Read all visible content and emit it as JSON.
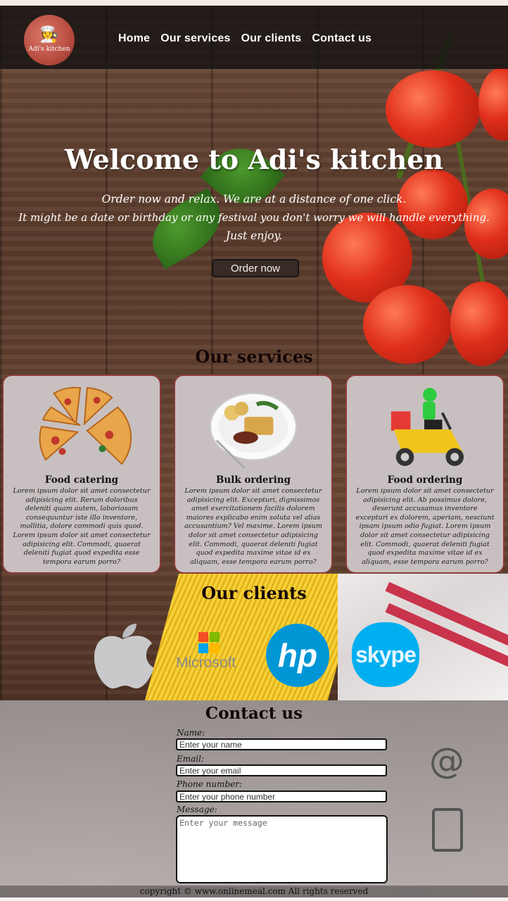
{
  "header": {
    "logo_text": "Adi's kitchen",
    "nav": [
      "Home",
      "Our services",
      "Our clients",
      "Contact us"
    ]
  },
  "hero": {
    "title": "Welcome to Adi's kitchen",
    "lines": [
      "Order now and relax. We are at a distance of one click.",
      "It might be a date or birthday or any festival you don't worry we will handle everything.",
      "Just enjoy."
    ],
    "order_button": "Order now"
  },
  "services": {
    "title": "Our services",
    "cards": [
      {
        "title": "Food catering",
        "icon": "pizza-icon",
        "text": "Lorem ipsum dolor sit amet consectetur adipisicing elit. Rerum doloribus deleniti quam autem, laboriosam consequuntur iste illo inventore, mollitia, dolore commodi quis quod. Lorem ipsum dolor sit amet consectetur adipisicing elit. Commodi, quaerat deleniti fugiat quod expedita esse tempora earum porro?"
      },
      {
        "title": "Bulk ordering",
        "icon": "meal-plate-icon",
        "text": "Lorem ipsum dolor sit amet consectetur adipisicing elit. Excepturi, dignissimos amet exercitationem facilis dolorem maiores explicabo enim soluta vel alias accusantium? Vel maxime. Lorem ipsum dolor sit amet consectetur adipisicing elit. Commodi, quaerat deleniti fugiat quod expedita maxime vitae id ex aliquam, esse tempora earum porro?"
      },
      {
        "title": "Food ordering",
        "icon": "delivery-scooter-icon",
        "text": "Lorem ipsum dolor sit amet consectetur adipisicing elit. Ab possimus dolore, deserunt accusamus inventore excepturi ex dolorem, aperiam, nesciunt ipsam ipsum odio fugiat. Lorem ipsum dolor sit amet consectetur adipisicing elit. Commodi, quaerat deleniti fugiat quod expedita maxime vitae id ex aliquam, esse tempora earum porro?"
      }
    ]
  },
  "clients": {
    "title": "Our clients",
    "logos": [
      "apple-logo",
      "Microsoft",
      "hp",
      "skype"
    ]
  },
  "contact": {
    "title": "Contact us",
    "name_label": "Name:",
    "name_placeholder": "Enter your name",
    "email_label": "Email:",
    "email_placeholder": "Enter your email",
    "phone_label": "Phone number:",
    "phone_placeholder": "Enter your phone number",
    "message_label": "Message:",
    "message_placeholder": "Enter your message"
  },
  "footer": {
    "text": "copyright © www.onlinemeal.com All rights reserved"
  },
  "colors": {
    "header_bg": "#141212",
    "card_bg": "#c8c0c0",
    "card_border": "#8e3a3a",
    "title_text": "#150707"
  }
}
